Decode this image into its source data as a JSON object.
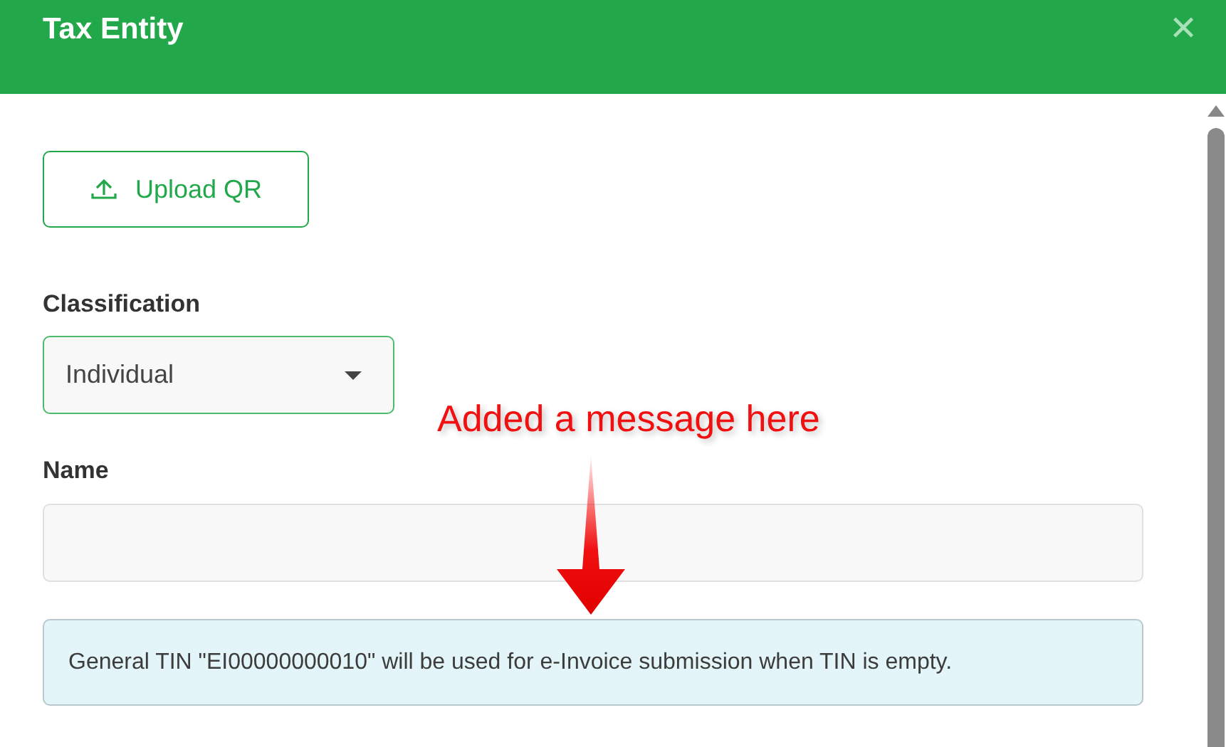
{
  "dialog": {
    "title": "Tax Entity",
    "close_icon": "✕"
  },
  "upload_button": {
    "label": "Upload QR"
  },
  "classification": {
    "label": "Classification",
    "value": "Individual"
  },
  "name": {
    "label": "Name"
  },
  "info_message": "General TIN \"EI00000000010\" will be used for e-Invoice submission when TIN is empty.",
  "annotation": {
    "text": "Added a message here"
  }
}
